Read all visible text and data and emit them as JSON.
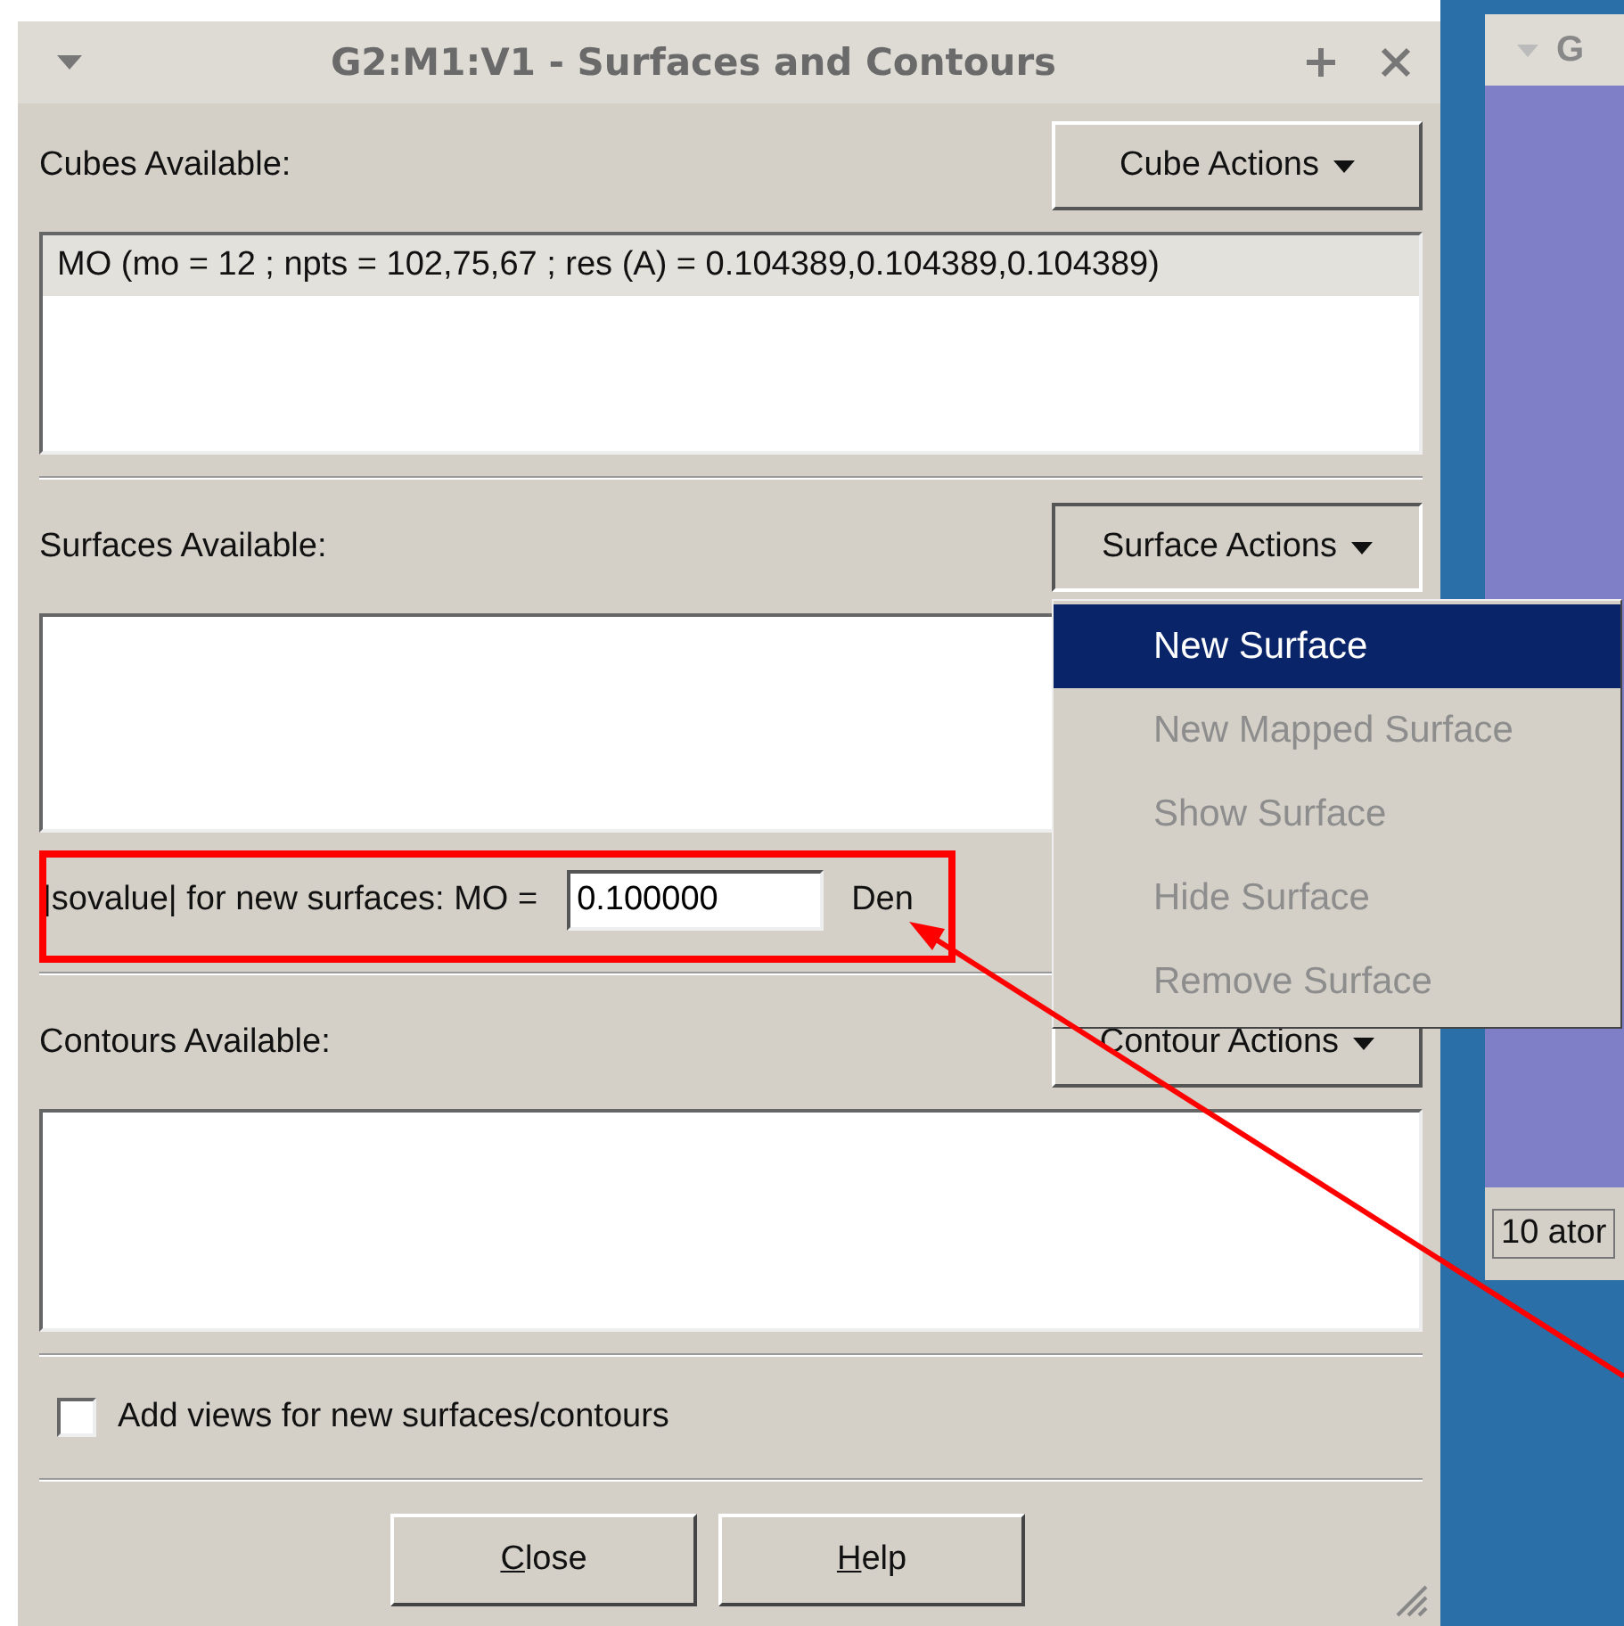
{
  "window": {
    "title": "G2:M1:V1 - Surfaces and Contours"
  },
  "cubes": {
    "label": "Cubes Available:",
    "action": "Cube Actions",
    "rows": [
      {
        "text": "MO (mo = 12 ; npts = 102,75,67 ; res (A) = 0.104389,0.104389,0.104389)",
        "selected": true
      }
    ]
  },
  "surfaces": {
    "label": "Surfaces Available:",
    "action": "Surface Actions"
  },
  "isovalue": {
    "label": "|sovalue| for new surfaces:  MO =",
    "value": "0.100000",
    "next_label": "Den"
  },
  "contours": {
    "label": "Contours Available:",
    "action": "Contour Actions"
  },
  "add_views": {
    "label": "Add views for new surfaces/contours",
    "checked": false
  },
  "buttons": [
    {
      "label": "Close"
    },
    {
      "label": "Help"
    }
  ],
  "menu": [
    {
      "label": "New Surface",
      "selected": true,
      "disabled": false
    },
    {
      "label": "New Mapped Surface",
      "selected": false,
      "disabled": true
    },
    {
      "label": "Show Surface",
      "selected": false,
      "disabled": true
    },
    {
      "label": "Hide Surface",
      "selected": false,
      "disabled": true
    },
    {
      "label": "Remove Surface",
      "selected": false,
      "disabled": true
    }
  ],
  "back_window": {
    "title": "G",
    "status": "10 ator"
  }
}
